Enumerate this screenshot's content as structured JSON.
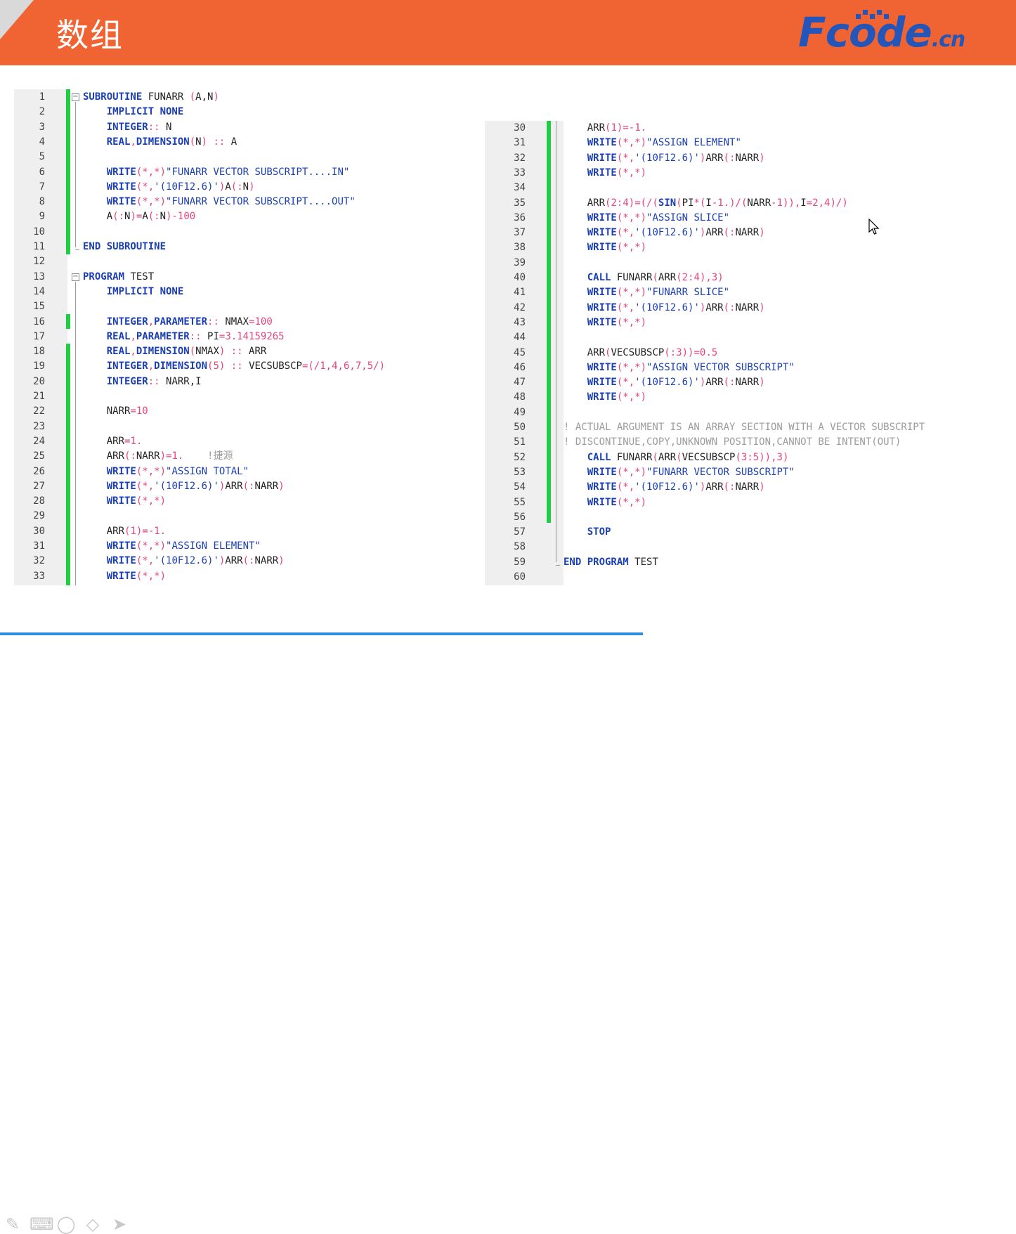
{
  "header": {
    "title": "数组",
    "logo_main": "Fcode",
    "logo_suffix": ".cn"
  },
  "colors": {
    "header_bg": "#ef6432",
    "keyword": "#1b3fb4",
    "number": "#e7447a",
    "comment": "#9c9c9c",
    "change_bar": "#22cc44",
    "progress": "#2f8ee0"
  },
  "editor_left": {
    "lines": [
      [
        [
          "fold",
          "open"
        ],
        [
          "kw",
          "SUBROUTINE"
        ],
        [
          "id",
          " FUNARR "
        ],
        [
          "op",
          "("
        ],
        [
          "id",
          "A,N"
        ],
        [
          "op",
          ")"
        ]
      ],
      [
        [
          "id",
          "    "
        ],
        [
          "kw",
          "IMPLICIT NONE"
        ]
      ],
      [
        [
          "id",
          "    "
        ],
        [
          "kw",
          "INTEGER"
        ],
        [
          "op",
          "::"
        ],
        [
          "id",
          " N"
        ]
      ],
      [
        [
          "id",
          "    "
        ],
        [
          "kw",
          "REAL"
        ],
        [
          "op",
          ","
        ],
        [
          "kw",
          "DIMENSION"
        ],
        [
          "op",
          "("
        ],
        [
          "id",
          "N"
        ],
        [
          "op",
          ")"
        ],
        [
          "op",
          " ::"
        ],
        [
          "id",
          " A"
        ]
      ],
      [
        [
          "id",
          ""
        ]
      ],
      [
        [
          "id",
          "    "
        ],
        [
          "kw",
          "WRITE"
        ],
        [
          "op",
          "(*,*)"
        ],
        [
          "str",
          "\"FUNARR VECTOR SUBSCRIPT....IN\""
        ]
      ],
      [
        [
          "id",
          "    "
        ],
        [
          "kw",
          "WRITE"
        ],
        [
          "op",
          "(*,"
        ],
        [
          "str",
          "'(10F12.6)'"
        ],
        [
          "op",
          ")"
        ],
        [
          "id",
          "A"
        ],
        [
          "op",
          "(:"
        ],
        [
          "id",
          "N"
        ],
        [
          "op",
          ")"
        ]
      ],
      [
        [
          "id",
          "    "
        ],
        [
          "kw",
          "WRITE"
        ],
        [
          "op",
          "(*,*)"
        ],
        [
          "str",
          "\"FUNARR VECTOR SUBSCRIPT....OUT\""
        ]
      ],
      [
        [
          "id",
          "    A"
        ],
        [
          "op",
          "(:"
        ],
        [
          "id",
          "N"
        ],
        [
          "op",
          ")="
        ],
        [
          "id",
          "A"
        ],
        [
          "op",
          "(:"
        ],
        [
          "id",
          "N"
        ],
        [
          "op",
          ")-"
        ],
        [
          "num",
          "100"
        ]
      ],
      [
        [
          "id",
          ""
        ]
      ],
      [
        [
          "fold",
          "end"
        ],
        [
          "kw",
          "END SUBROUTINE"
        ]
      ],
      [
        [
          "id",
          ""
        ]
      ],
      [
        [
          "fold",
          "open"
        ],
        [
          "kw",
          "PROGRAM"
        ],
        [
          "id",
          " TEST"
        ]
      ],
      [
        [
          "id",
          "    "
        ],
        [
          "kw",
          "IMPLICIT NONE"
        ]
      ],
      [
        [
          "id",
          ""
        ]
      ],
      [
        [
          "id",
          "    "
        ],
        [
          "kw",
          "INTEGER"
        ],
        [
          "op",
          ","
        ],
        [
          "kw",
          "PARAMETER"
        ],
        [
          "op",
          "::"
        ],
        [
          "id",
          " NMAX"
        ],
        [
          "op",
          "="
        ],
        [
          "num",
          "100"
        ]
      ],
      [
        [
          "id",
          "    "
        ],
        [
          "kw",
          "REAL"
        ],
        [
          "op",
          ","
        ],
        [
          "kw",
          "PARAMETER"
        ],
        [
          "op",
          "::"
        ],
        [
          "id",
          " PI"
        ],
        [
          "op",
          "="
        ],
        [
          "num",
          "3.14159265"
        ]
      ],
      [
        [
          "id",
          "    "
        ],
        [
          "kw",
          "REAL"
        ],
        [
          "op",
          ","
        ],
        [
          "kw",
          "DIMENSION"
        ],
        [
          "op",
          "("
        ],
        [
          "id",
          "NMAX"
        ],
        [
          "op",
          ")"
        ],
        [
          "op",
          " ::"
        ],
        [
          "id",
          " ARR"
        ]
      ],
      [
        [
          "id",
          "    "
        ],
        [
          "kw",
          "INTEGER"
        ],
        [
          "op",
          ","
        ],
        [
          "kw",
          "DIMENSION"
        ],
        [
          "op",
          "("
        ],
        [
          "num",
          "5"
        ],
        [
          "op",
          ")"
        ],
        [
          "op",
          " ::"
        ],
        [
          "id",
          " VECSUBSCP"
        ],
        [
          "op",
          "=(/"
        ],
        [
          "num",
          "1"
        ],
        [
          "op",
          ","
        ],
        [
          "num",
          "4"
        ],
        [
          "op",
          ","
        ],
        [
          "num",
          "6"
        ],
        [
          "op",
          ","
        ],
        [
          "num",
          "7"
        ],
        [
          "op",
          ","
        ],
        [
          "num",
          "5"
        ],
        [
          "op",
          "/)"
        ]
      ],
      [
        [
          "id",
          "    "
        ],
        [
          "kw",
          "INTEGER"
        ],
        [
          "op",
          "::"
        ],
        [
          "id",
          " NARR,I"
        ]
      ],
      [
        [
          "id",
          ""
        ]
      ],
      [
        [
          "id",
          "    NARR"
        ],
        [
          "op",
          "="
        ],
        [
          "num",
          "10"
        ]
      ],
      [
        [
          "id",
          ""
        ]
      ],
      [
        [
          "id",
          "    ARR"
        ],
        [
          "op",
          "="
        ],
        [
          "num",
          "1."
        ]
      ],
      [
        [
          "id",
          "    ARR"
        ],
        [
          "op",
          "(:"
        ],
        [
          "id",
          "NARR"
        ],
        [
          "op",
          ")="
        ],
        [
          "num",
          "1."
        ],
        [
          "id",
          "    "
        ],
        [
          "cm",
          "!捷源"
        ]
      ],
      [
        [
          "id",
          "    "
        ],
        [
          "kw",
          "WRITE"
        ],
        [
          "op",
          "(*,*)"
        ],
        [
          "str",
          "\"ASSIGN TOTAL\""
        ]
      ],
      [
        [
          "id",
          "    "
        ],
        [
          "kw",
          "WRITE"
        ],
        [
          "op",
          "(*,"
        ],
        [
          "str",
          "'(10F12.6)'"
        ],
        [
          "op",
          ")"
        ],
        [
          "id",
          "ARR"
        ],
        [
          "op",
          "(:"
        ],
        [
          "id",
          "NARR"
        ],
        [
          "op",
          ")"
        ]
      ],
      [
        [
          "id",
          "    "
        ],
        [
          "kw",
          "WRITE"
        ],
        [
          "op",
          "(*,*)"
        ]
      ],
      [
        [
          "id",
          ""
        ]
      ],
      [
        [
          "id",
          "    ARR"
        ],
        [
          "op",
          "("
        ],
        [
          "num",
          "1"
        ],
        [
          "op",
          ")=-"
        ],
        [
          "num",
          "1."
        ]
      ],
      [
        [
          "id",
          "    "
        ],
        [
          "kw",
          "WRITE"
        ],
        [
          "op",
          "(*,*)"
        ],
        [
          "str",
          "\"ASSIGN ELEMENT\""
        ]
      ],
      [
        [
          "id",
          "    "
        ],
        [
          "kw",
          "WRITE"
        ],
        [
          "op",
          "(*,"
        ],
        [
          "str",
          "'(10F12.6)'"
        ],
        [
          "op",
          ")"
        ],
        [
          "id",
          "ARR"
        ],
        [
          "op",
          "(:"
        ],
        [
          "id",
          "NARR"
        ],
        [
          "op",
          ")"
        ]
      ],
      [
        [
          "id",
          "    "
        ],
        [
          "kw",
          "WRITE"
        ],
        [
          "op",
          "(*,*)"
        ]
      ]
    ],
    "line_numbers": [
      "1",
      "2",
      "3",
      "4",
      "5",
      "6",
      "7",
      "8",
      "9",
      "10",
      "11",
      "12",
      "13",
      "14",
      "15",
      "16",
      "17",
      "18",
      "19",
      "20",
      "21",
      "22",
      "23",
      "24",
      "25",
      "26",
      "27",
      "28",
      "29",
      "30",
      "31",
      "32",
      "33"
    ]
  },
  "editor_right": {
    "lines": [
      [
        [
          "id",
          "    ARR"
        ],
        [
          "op",
          "("
        ],
        [
          "num",
          "1"
        ],
        [
          "op",
          ")=-"
        ],
        [
          "num",
          "1."
        ]
      ],
      [
        [
          "id",
          "    "
        ],
        [
          "kw",
          "WRITE"
        ],
        [
          "op",
          "(*,*)"
        ],
        [
          "str",
          "\"ASSIGN ELEMENT\""
        ]
      ],
      [
        [
          "id",
          "    "
        ],
        [
          "kw",
          "WRITE"
        ],
        [
          "op",
          "(*,"
        ],
        [
          "str",
          "'(10F12.6)'"
        ],
        [
          "op",
          ")"
        ],
        [
          "id",
          "ARR"
        ],
        [
          "op",
          "(:"
        ],
        [
          "id",
          "NARR"
        ],
        [
          "op",
          ")"
        ]
      ],
      [
        [
          "id",
          "    "
        ],
        [
          "kw",
          "WRITE"
        ],
        [
          "op",
          "(*,*)"
        ]
      ],
      [
        [
          "id",
          ""
        ]
      ],
      [
        [
          "id",
          "    ARR"
        ],
        [
          "op",
          "("
        ],
        [
          "num",
          "2"
        ],
        [
          "op",
          ":"
        ],
        [
          "num",
          "4"
        ],
        [
          "op",
          ")=(/("
        ],
        [
          "kw",
          "SIN"
        ],
        [
          "op",
          "("
        ],
        [
          "id",
          "PI"
        ],
        [
          "op",
          "*("
        ],
        [
          "id",
          "I"
        ],
        [
          "op",
          "-"
        ],
        [
          "num",
          "1."
        ],
        [
          "op",
          ")/("
        ],
        [
          "id",
          "NARR"
        ],
        [
          "op",
          "-"
        ],
        [
          "num",
          "1"
        ],
        [
          "op",
          "))"
        ],
        [
          "op",
          ","
        ],
        [
          "id",
          "I"
        ],
        [
          "op",
          "="
        ],
        [
          "num",
          "2"
        ],
        [
          "op",
          ","
        ],
        [
          "num",
          "4"
        ],
        [
          "op",
          ")/)"
        ]
      ],
      [
        [
          "id",
          "    "
        ],
        [
          "kw",
          "WRITE"
        ],
        [
          "op",
          "(*,*)"
        ],
        [
          "str",
          "\"ASSIGN SLICE\""
        ]
      ],
      [
        [
          "id",
          "    "
        ],
        [
          "kw",
          "WRITE"
        ],
        [
          "op",
          "(*,"
        ],
        [
          "str",
          "'(10F12.6)'"
        ],
        [
          "op",
          ")"
        ],
        [
          "id",
          "ARR"
        ],
        [
          "op",
          "(:"
        ],
        [
          "id",
          "NARR"
        ],
        [
          "op",
          ")"
        ]
      ],
      [
        [
          "id",
          "    "
        ],
        [
          "kw",
          "WRITE"
        ],
        [
          "op",
          "(*,*)"
        ]
      ],
      [
        [
          "id",
          ""
        ]
      ],
      [
        [
          "id",
          "    "
        ],
        [
          "kw",
          "CALL"
        ],
        [
          "id",
          " FUNARR"
        ],
        [
          "op",
          "("
        ],
        [
          "id",
          "ARR"
        ],
        [
          "op",
          "("
        ],
        [
          "num",
          "2"
        ],
        [
          "op",
          ":"
        ],
        [
          "num",
          "4"
        ],
        [
          "op",
          "),"
        ],
        [
          "num",
          "3"
        ],
        [
          "op",
          ")"
        ]
      ],
      [
        [
          "id",
          "    "
        ],
        [
          "kw",
          "WRITE"
        ],
        [
          "op",
          "(*,*)"
        ],
        [
          "str",
          "\"FUNARR SLICE\""
        ]
      ],
      [
        [
          "id",
          "    "
        ],
        [
          "kw",
          "WRITE"
        ],
        [
          "op",
          "(*,"
        ],
        [
          "str",
          "'(10F12.6)'"
        ],
        [
          "op",
          ")"
        ],
        [
          "id",
          "ARR"
        ],
        [
          "op",
          "(:"
        ],
        [
          "id",
          "NARR"
        ],
        [
          "op",
          ")"
        ]
      ],
      [
        [
          "id",
          "    "
        ],
        [
          "kw",
          "WRITE"
        ],
        [
          "op",
          "(*,*)"
        ]
      ],
      [
        [
          "id",
          ""
        ]
      ],
      [
        [
          "id",
          "    ARR"
        ],
        [
          "op",
          "("
        ],
        [
          "id",
          "VECSUBSCP"
        ],
        [
          "op",
          "(:"
        ],
        [
          "num",
          "3"
        ],
        [
          "op",
          "))="
        ],
        [
          "num",
          "0.5"
        ]
      ],
      [
        [
          "id",
          "    "
        ],
        [
          "kw",
          "WRITE"
        ],
        [
          "op",
          "(*,*)"
        ],
        [
          "str",
          "\"ASSIGN VECTOR SUBSCRIPT\""
        ]
      ],
      [
        [
          "id",
          "    "
        ],
        [
          "kw",
          "WRITE"
        ],
        [
          "op",
          "(*,"
        ],
        [
          "str",
          "'(10F12.6)'"
        ],
        [
          "op",
          ")"
        ],
        [
          "id",
          "ARR"
        ],
        [
          "op",
          "(:"
        ],
        [
          "id",
          "NARR"
        ],
        [
          "op",
          ")"
        ]
      ],
      [
        [
          "id",
          "    "
        ],
        [
          "kw",
          "WRITE"
        ],
        [
          "op",
          "(*,*)"
        ]
      ],
      [
        [
          "id",
          ""
        ]
      ],
      [
        [
          "cm",
          "! ACTUAL ARGUMENT IS AN ARRAY SECTION WITH A VECTOR SUBSCRIPT"
        ]
      ],
      [
        [
          "cm",
          "! DISCONTINUE,COPY,UNKNOWN POSITION,CANNOT BE INTENT(OUT)"
        ]
      ],
      [
        [
          "id",
          "    "
        ],
        [
          "kw",
          "CALL"
        ],
        [
          "id",
          " FUNARR"
        ],
        [
          "op",
          "("
        ],
        [
          "id",
          "ARR"
        ],
        [
          "op",
          "("
        ],
        [
          "id",
          "VECSUBSCP"
        ],
        [
          "op",
          "("
        ],
        [
          "num",
          "3"
        ],
        [
          "op",
          ":"
        ],
        [
          "num",
          "5"
        ],
        [
          "op",
          ")),"
        ],
        [
          "num",
          "3"
        ],
        [
          "op",
          ")"
        ]
      ],
      [
        [
          "id",
          "    "
        ],
        [
          "kw",
          "WRITE"
        ],
        [
          "op",
          "(*,*)"
        ],
        [
          "str",
          "\"FUNARR VECTOR SUBSCRIPT\""
        ]
      ],
      [
        [
          "id",
          "    "
        ],
        [
          "kw",
          "WRITE"
        ],
        [
          "op",
          "(*,"
        ],
        [
          "str",
          "'(10F12.6)'"
        ],
        [
          "op",
          ")"
        ],
        [
          "id",
          "ARR"
        ],
        [
          "op",
          "(:"
        ],
        [
          "id",
          "NARR"
        ],
        [
          "op",
          ")"
        ]
      ],
      [
        [
          "id",
          "    "
        ],
        [
          "kw",
          "WRITE"
        ],
        [
          "op",
          "(*,*)"
        ]
      ],
      [
        [
          "id",
          ""
        ]
      ],
      [
        [
          "id",
          "    "
        ],
        [
          "kw",
          "STOP"
        ]
      ],
      [
        [
          "id",
          ""
        ]
      ],
      [
        [
          "fold",
          "end"
        ],
        [
          "kw",
          "END PROGRAM"
        ],
        [
          "id",
          " TEST"
        ]
      ],
      [
        [
          "id",
          ""
        ]
      ]
    ],
    "line_numbers": [
      "30",
      "31",
      "32",
      "33",
      "34",
      "35",
      "36",
      "37",
      "38",
      "39",
      "40",
      "41",
      "42",
      "43",
      "44",
      "45",
      "46",
      "47",
      "48",
      "49",
      "50",
      "51",
      "52",
      "53",
      "54",
      "55",
      "56",
      "57",
      "58",
      "59",
      "60"
    ]
  },
  "toolbar": {
    "icons": [
      "pen-icon",
      "keyboard-icon",
      "lasso-icon",
      "eraser-icon",
      "pointer-icon"
    ]
  }
}
